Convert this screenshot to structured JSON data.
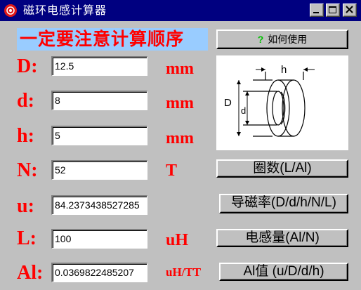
{
  "window": {
    "title": "磁环电感计算器"
  },
  "banner": "一定要注意计算顺序",
  "help_button": {
    "mark": "?",
    "label": "如何使用"
  },
  "fields": [
    {
      "key": "D",
      "label": "D:",
      "value": "12.5",
      "unit": "mm"
    },
    {
      "key": "d",
      "label": "d:",
      "value": "8",
      "unit": "mm"
    },
    {
      "key": "h",
      "label": "h:",
      "value": "5",
      "unit": "mm"
    },
    {
      "key": "N",
      "label": "N:",
      "value": "52",
      "unit": "T"
    },
    {
      "key": "u",
      "label": "u:",
      "value": "84.2373438527285",
      "unit": ""
    },
    {
      "key": "L",
      "label": "L:",
      "value": "100",
      "unit": "uH"
    },
    {
      "key": "Al",
      "label": "Al:",
      "value": "0.0369822485207",
      "unit": "uH/TT"
    }
  ],
  "buttons": {
    "turns": "圈数(L/Al)",
    "permeability": "导磁率(D/d/h/N/L)",
    "inductance": "电感量(Al/N)",
    "al_value": "Al值 (u/D/d/h)"
  },
  "diagram": {
    "labels": [
      "h",
      "D",
      "d"
    ]
  },
  "colors": {
    "titlebar": "#000080",
    "label_red": "#ff0000",
    "banner_bg": "#99ccff",
    "window_bg": "#c0c0c0"
  }
}
